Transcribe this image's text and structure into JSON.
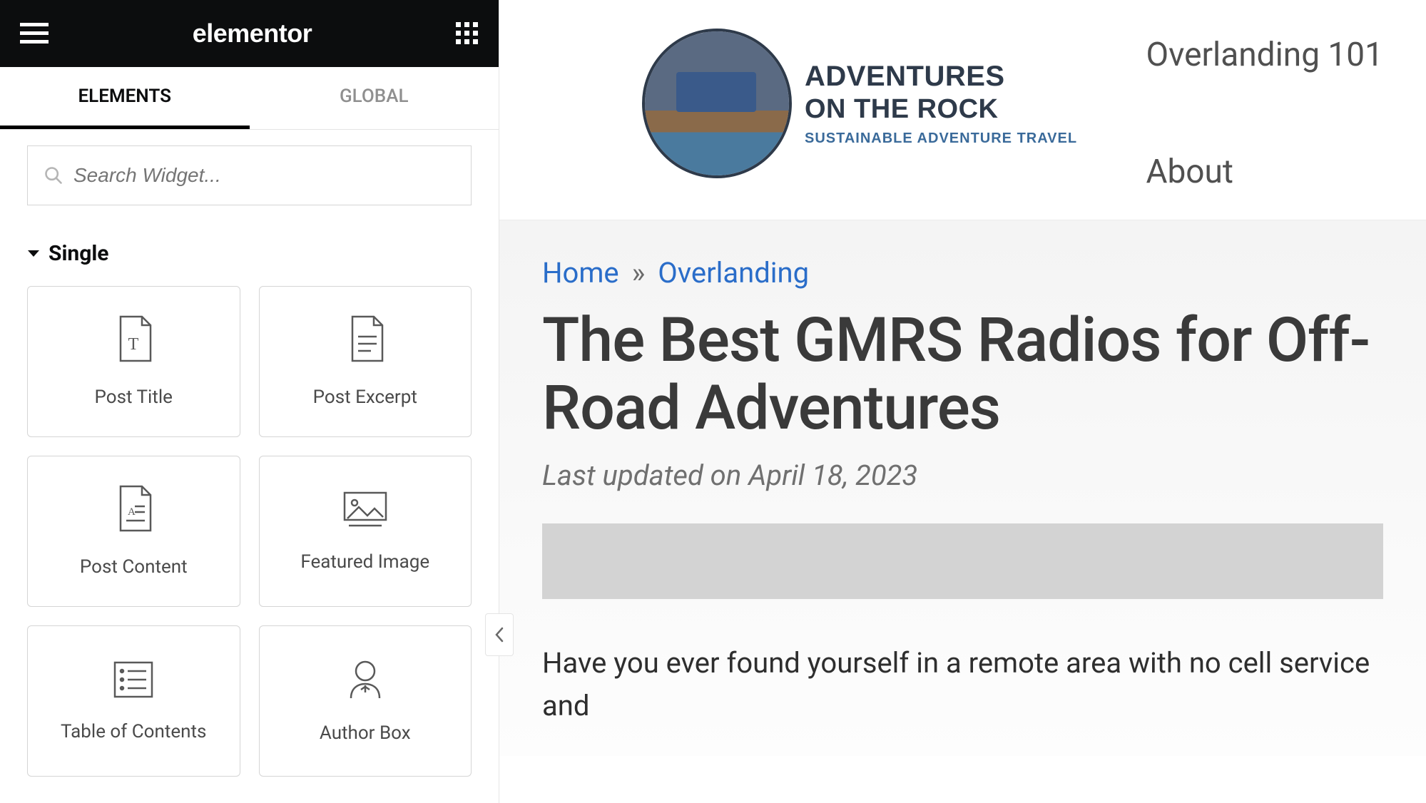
{
  "sidebar": {
    "brand": "elementor",
    "tabs": {
      "elements": "ELEMENTS",
      "global": "GLOBAL"
    },
    "search_placeholder": "Search Widget...",
    "category": "Single",
    "widgets": [
      {
        "id": "post-title",
        "label": "Post Title"
      },
      {
        "id": "post-excerpt",
        "label": "Post Excerpt"
      },
      {
        "id": "post-content",
        "label": "Post Content"
      },
      {
        "id": "featured-image",
        "label": "Featured Image"
      },
      {
        "id": "table-of-contents",
        "label": "Table of Contents"
      },
      {
        "id": "author-box",
        "label": "Author Box"
      }
    ]
  },
  "site": {
    "logo": {
      "line1": "ADVENTURES",
      "line2": "ON THE ROCK",
      "tagline": "SUSTAINABLE ADVENTURE TRAVEL"
    },
    "nav": {
      "item1": "Overlanding 101",
      "item2": "About"
    }
  },
  "breadcrumb": {
    "home": "Home",
    "sep": "»",
    "cat": "Overlanding"
  },
  "post": {
    "title": "The Best GMRS Radios for Off-Road Adventures",
    "meta": "Last updated on April 18, 2023",
    "body_excerpt": "Have you ever found yourself in a remote area with no cell service and"
  }
}
